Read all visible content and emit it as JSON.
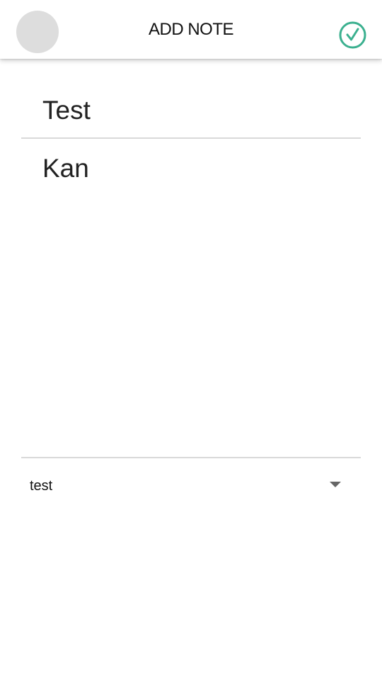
{
  "app_bar": {
    "title": "ADD NOTE",
    "save_icon": "check-circle-icon",
    "accent_color": "#3bb08f"
  },
  "note": {
    "title_value": "Test",
    "body_value": "Kan"
  },
  "category": {
    "selected": "test",
    "arrow_icon": "triangle-down-icon"
  }
}
